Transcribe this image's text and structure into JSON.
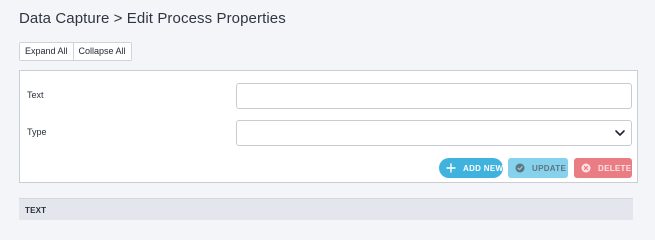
{
  "header": {
    "title": "Data Capture > Edit Process Properties"
  },
  "toolbar": {
    "expand_all_label": "Expand All",
    "collapse_all_label": "Collapse All"
  },
  "form": {
    "text_label": "Text",
    "text_value": "",
    "type_label": "Type",
    "type_selected": ""
  },
  "actions": {
    "add_new_label": "ADD NEW",
    "update_label": "UPDATE",
    "delete_label": "DELETE"
  },
  "table": {
    "columns": [
      "TEXT"
    ]
  },
  "icons": {
    "add": "plus-icon",
    "update": "check-circle-icon",
    "delete": "close-circle-icon",
    "select": "chevron-down-icon"
  },
  "colors": {
    "add_button": "#3fb3de",
    "update_button": "#86d1ec",
    "delete_button": "#ea7c84"
  }
}
